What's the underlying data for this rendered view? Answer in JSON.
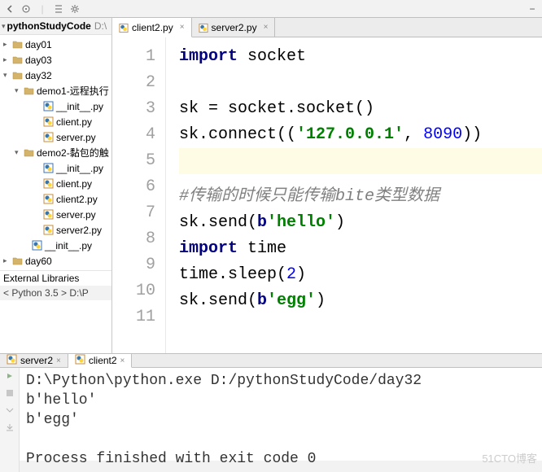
{
  "project": {
    "name": "pythonStudyCode",
    "path": "D:\\"
  },
  "tree": [
    {
      "label": "day01",
      "type": "folder",
      "indent": 4,
      "arrow": "▸"
    },
    {
      "label": "day03",
      "type": "folder",
      "indent": 4,
      "arrow": "▸"
    },
    {
      "label": "day32",
      "type": "folder",
      "indent": 4,
      "arrow": "▾"
    },
    {
      "label": "demo1-远程执行",
      "type": "folder",
      "indent": 18,
      "arrow": "▾"
    },
    {
      "label": "__init__.py",
      "type": "init",
      "indent": 42,
      "arrow": ""
    },
    {
      "label": "client.py",
      "type": "py",
      "indent": 42,
      "arrow": ""
    },
    {
      "label": "server.py",
      "type": "py",
      "indent": 42,
      "arrow": ""
    },
    {
      "label": "demo2-黏包的触",
      "type": "folder",
      "indent": 18,
      "arrow": "▾"
    },
    {
      "label": "__init__.py",
      "type": "init",
      "indent": 42,
      "arrow": ""
    },
    {
      "label": "client.py",
      "type": "py",
      "indent": 42,
      "arrow": ""
    },
    {
      "label": "client2.py",
      "type": "py",
      "indent": 42,
      "arrow": ""
    },
    {
      "label": "server.py",
      "type": "py",
      "indent": 42,
      "arrow": ""
    },
    {
      "label": "server2.py",
      "type": "py",
      "indent": 42,
      "arrow": ""
    },
    {
      "label": "__init__.py",
      "type": "init",
      "indent": 28,
      "arrow": ""
    },
    {
      "label": "day60",
      "type": "folder",
      "indent": 4,
      "arrow": "▸"
    }
  ],
  "ext_lib": "External Libraries",
  "breadcrumb": "< Python 3.5 >  D:\\P",
  "tabs": [
    {
      "label": "client2.py",
      "active": true
    },
    {
      "label": "server2.py",
      "active": false
    }
  ],
  "gutter": [
    "1",
    "2",
    "3",
    "4",
    "5",
    "6",
    "7",
    "8",
    "9",
    "10",
    "11"
  ],
  "code": {
    "l1": {
      "kw": "import",
      "rest": " socket"
    },
    "l3_a": "sk = socket.socket()",
    "l4_a": "sk.connect((",
    "l4_str": "'127.0.0.1'",
    "l4_b": ", ",
    "l4_num": "8090",
    "l4_c": "))",
    "l6_cmt": "#传输的时候只能传输bite类型数据",
    "l7_a": "sk.send(",
    "l7_b": "b",
    "l7_str": "'hello'",
    "l7_c": ")",
    "l8_kw": "import",
    "l8_rest": " time",
    "l9_a": "time.sleep(",
    "l9_num": "2",
    "l9_b": ")",
    "l10_a": "sk.send(",
    "l10_b": "b",
    "l10_str": "'egg'",
    "l10_c": ")"
  },
  "bottom_tabs": [
    {
      "label": "server2",
      "active": false
    },
    {
      "label": "client2",
      "active": true
    }
  ],
  "console": {
    "l1": "D:\\Python\\python.exe D:/pythonStudyCode/day32",
    "l2": "b'hello'",
    "l3": "b'egg'",
    "l4": "",
    "l5": "Process finished with exit code 0"
  },
  "watermark": "51CTO博客"
}
